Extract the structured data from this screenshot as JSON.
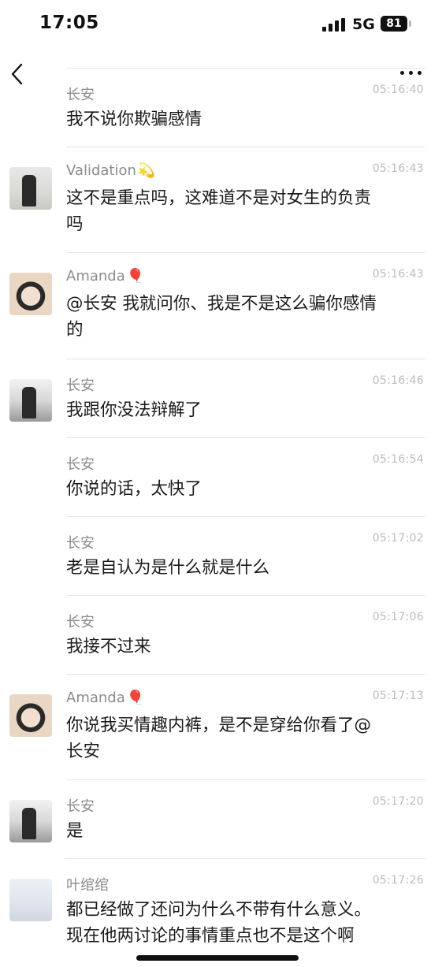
{
  "status_bar": {
    "time": "17:05",
    "network": "5G",
    "battery": "81"
  },
  "nav": {
    "back_icon": "chevron-left-icon",
    "more_icon": "more-dots-icon"
  },
  "messages": [
    {
      "sender": "长安",
      "emoji": "",
      "time": "05:16:40",
      "avatar": "none",
      "lines": [
        "我不说你欺骗感情"
      ]
    },
    {
      "sender": "Validation",
      "emoji": "💫",
      "time": "05:16:43",
      "avatar": "validation",
      "lines": [
        "这不是重点吗，这难道不是对女生的负责",
        "吗"
      ]
    },
    {
      "sender": "Amanda",
      "emoji": "🎈",
      "time": "05:16:43",
      "avatar": "amanda",
      "lines": [
        "@长安 我就问你、我是不是这么骗你感情",
        "的"
      ]
    },
    {
      "sender": "长安",
      "emoji": "",
      "time": "05:16:46",
      "avatar": "changan",
      "lines": [
        "我跟你没法辩解了"
      ]
    },
    {
      "sender": "长安",
      "emoji": "",
      "time": "05:16:54",
      "avatar": "none",
      "lines": [
        "你说的话，太快了"
      ]
    },
    {
      "sender": "长安",
      "emoji": "",
      "time": "05:17:02",
      "avatar": "none",
      "lines": [
        "老是自认为是什么就是什么"
      ]
    },
    {
      "sender": "长安",
      "emoji": "",
      "time": "05:17:06",
      "avatar": "none",
      "lines": [
        "我接不过来"
      ]
    },
    {
      "sender": "Amanda",
      "emoji": "🎈",
      "time": "05:17:13",
      "avatar": "amanda",
      "lines": [
        "你说我买情趣内裤，是不是穿给你看了@",
        "长安"
      ]
    },
    {
      "sender": "长安",
      "emoji": "",
      "time": "05:17:20",
      "avatar": "changan",
      "lines": [
        "是"
      ]
    },
    {
      "sender": "叶绾绾",
      "emoji": "",
      "time": "05:17:26",
      "avatar": "ye",
      "lines": [
        "都已经做了还问为什么不带有什么意义。",
        "现在他两讨论的事情重点也不是这个啊"
      ]
    }
  ]
}
